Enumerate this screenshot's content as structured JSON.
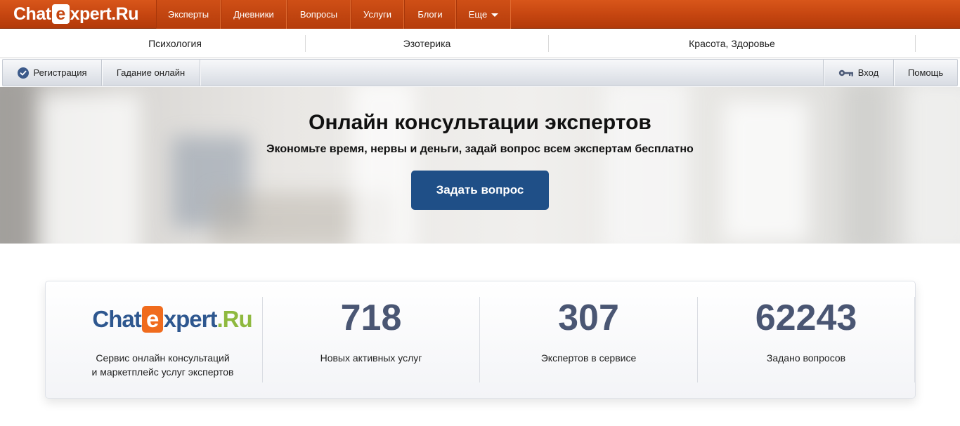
{
  "brand": {
    "logo_prefix": "Chat",
    "logo_e": "e",
    "logo_suffix": "xpert.Ru",
    "card_logo_prefix": "Chat",
    "card_logo_e": "e",
    "card_logo_mid": "xpert",
    "card_logo_ru": ".Ru",
    "colors": {
      "orange": "#c54510",
      "navy": "#1f4f87",
      "accent_orange": "#f06b1d",
      "green": "#8fb93f"
    }
  },
  "top_nav": {
    "items": [
      {
        "label": "Эксперты"
      },
      {
        "label": "Дневники"
      },
      {
        "label": "Вопросы"
      },
      {
        "label": "Услуги"
      },
      {
        "label": "Блоги"
      },
      {
        "label": "Еще"
      }
    ]
  },
  "categories": [
    {
      "label": "Психология"
    },
    {
      "label": "Эзотерика"
    },
    {
      "label": "Красота, Здоровье"
    }
  ],
  "toolbar": {
    "register_label": "Регистрация",
    "register_icon": "check-circle-icon",
    "fortune_label": "Гадание онлайн",
    "login_label": "Вход",
    "login_icon": "key-icon",
    "help_label": "Помощь"
  },
  "hero": {
    "title": "Онлайн консультации экспертов",
    "subtitle": "Экономьте время, нервы и деньги, задай вопрос всем экспертам бесплатно",
    "button_label": "Задать вопрос"
  },
  "stats": {
    "description_line1": "Сервис онлайн консультаций",
    "description_line2": "и маркетплейс услуг экспертов",
    "items": [
      {
        "value": "718",
        "label": "Новых активных услуг"
      },
      {
        "value": "307",
        "label": "Экспертов в сервисе"
      },
      {
        "value": "62243",
        "label": "Задано вопросов"
      }
    ]
  }
}
